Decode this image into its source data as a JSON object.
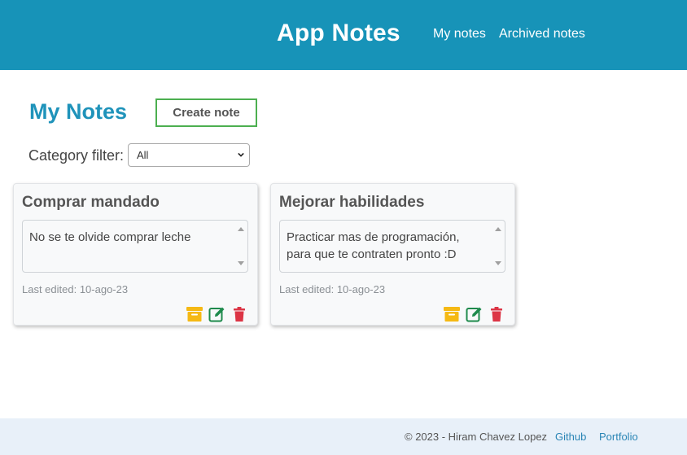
{
  "header": {
    "brand": "App Notes",
    "nav": [
      {
        "label": "My notes"
      },
      {
        "label": "Archived notes"
      }
    ]
  },
  "main": {
    "title": "My Notes",
    "create_label": "Create note",
    "filter": {
      "label": "Category filter:",
      "selected": "All"
    }
  },
  "notes": [
    {
      "title": "Comprar mandado",
      "body": "No se te olvide comprar leche",
      "last_edited": "Last edited: 10-ago-23"
    },
    {
      "title": "Mejorar habilidades",
      "body": "Practicar mas de programación, para que te contraten pronto :D",
      "last_edited": "Last edited: 10-ago-23"
    }
  ],
  "footer": {
    "copyright": "© 2023 - Hiram Chavez Lopez",
    "links": [
      {
        "label": "Github"
      },
      {
        "label": "Portfolio"
      }
    ]
  },
  "colors": {
    "header_bg": "#1793b8",
    "title": "#1f93ba",
    "create_border": "#4caf50",
    "archive_icon": "#f5b914",
    "edit_icon": "#1e8a4c",
    "delete_icon": "#dc3545",
    "footer_bg": "#e8f0f9",
    "footer_link": "#2a85b5"
  },
  "icons": [
    "archive-icon",
    "edit-icon",
    "trash-icon",
    "chevron-down-icon"
  ]
}
